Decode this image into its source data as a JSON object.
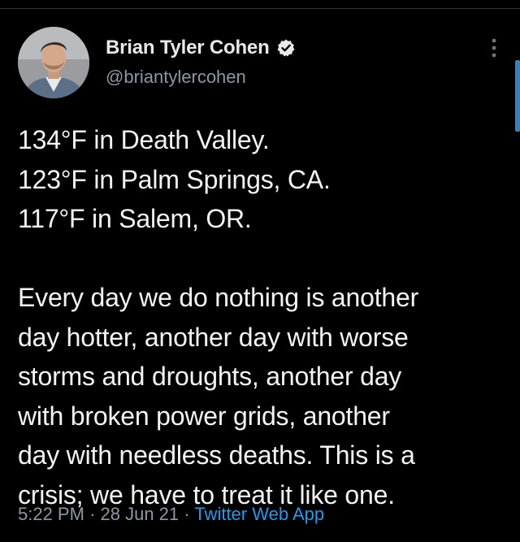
{
  "author": {
    "name": "Brian Tyler Cohen",
    "handle": "@briantylercohen",
    "verified_icon": "verified-badge-icon",
    "avatar_icon": "avatar"
  },
  "tweet": {
    "lines_block1": [
      "134°F in Death Valley.",
      "123°F in Palm Springs, CA.",
      "117°F in Salem, OR."
    ],
    "lines_block2": [
      "Every day we do nothing is another",
      "day hotter, another day with worse",
      "storms and droughts, another day",
      "with broken power grids, another",
      "day with needless deaths. This is a",
      "crisis; we have to treat it like one."
    ]
  },
  "meta": {
    "time": "5:22 PM",
    "date": "28 Jun 21",
    "separator": "·",
    "source": "Twitter Web App"
  },
  "colors": {
    "background": "#000000",
    "text": "#f2f3f4",
    "muted": "#8b98a5",
    "link": "#1d9bf0"
  },
  "icons": {
    "more": "more-vertical-icon"
  }
}
